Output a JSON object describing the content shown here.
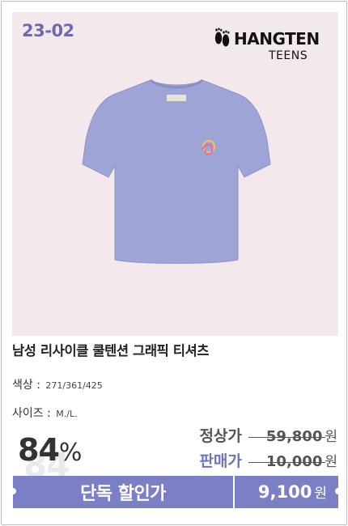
{
  "product_code": "23-02",
  "brand": {
    "name": "HANGTEN",
    "sub": "TEENS"
  },
  "product": {
    "title": "남성 리사이클 쿨텐션 그래픽 티셔츠",
    "color_label": "색상 :",
    "color_value": "271/361/425",
    "size_label": "사이즈 :",
    "size_value": "M./L."
  },
  "pricing": {
    "discount_number": "84",
    "discount_suffix": "%",
    "regular_label": "정상가",
    "regular_price": "59,800",
    "sale_label": "판매가",
    "sale_price": "10,000",
    "currency": "원"
  },
  "cta": {
    "label": "단독 할인가",
    "price": "9,100",
    "currency": "원"
  },
  "colors": {
    "accent": "#7b7fc5",
    "sale_label": "#6d74b8",
    "code_tag": "#6e6ab1",
    "image_bg": "#f3e9ec",
    "tshirt": "#9ea4d6"
  }
}
